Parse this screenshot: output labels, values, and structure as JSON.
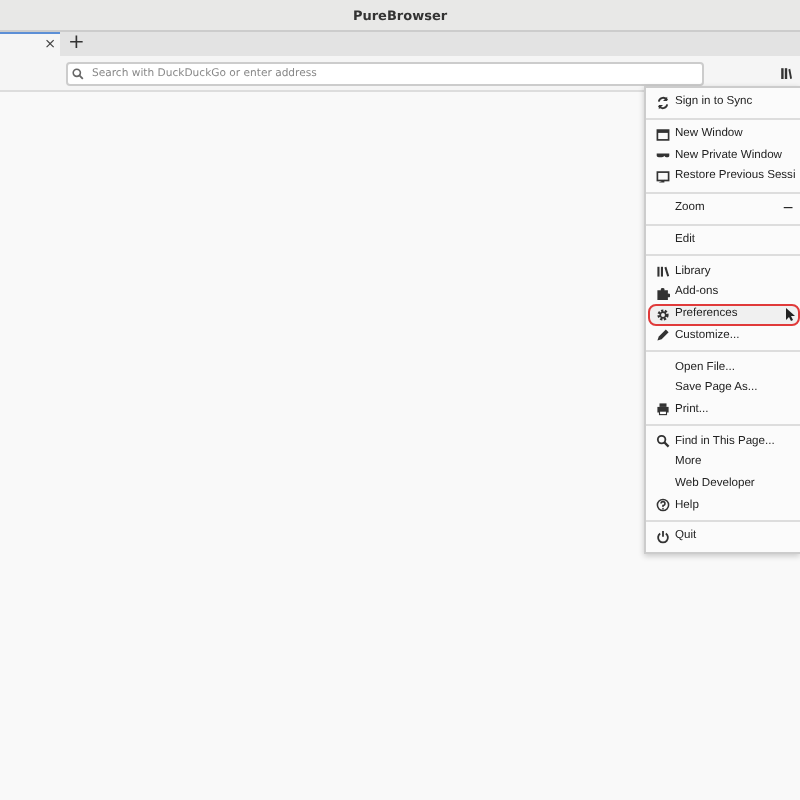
{
  "window": {
    "title": "PureBrowser"
  },
  "tabs": [
    {
      "close": "×",
      "selected": true
    }
  ],
  "new_tab": "+",
  "address_bar": {
    "placeholder": "Search with DuckDuckGo or enter address"
  },
  "menu": {
    "groups": [
      [
        {
          "kind": "item",
          "label": "Sign in to Sync",
          "highlighted": false
        }
      ],
      [
        {
          "kind": "item",
          "label": "New Window",
          "highlighted": false
        },
        {
          "kind": "item",
          "label": "New Private Window",
          "highlighted": false
        },
        {
          "kind": "item",
          "label": "Restore Previous Sessi",
          "highlighted": false
        }
      ],
      [
        {
          "kind": "zoom",
          "label": "Zoom",
          "control": "−",
          "highlighted": false
        }
      ],
      [
        {
          "kind": "item",
          "label": "Edit",
          "highlighted": false
        }
      ],
      [
        {
          "kind": "item",
          "label": "Library",
          "highlighted": false
        },
        {
          "kind": "item",
          "label": "Add-ons",
          "highlighted": false
        },
        {
          "kind": "item",
          "label": "Preferences",
          "highlighted": true
        },
        {
          "kind": "item",
          "label": "Customize...",
          "highlighted": false
        }
      ],
      [
        {
          "kind": "item",
          "label": "Open File...",
          "highlighted": false
        },
        {
          "kind": "item",
          "label": "Save Page As...",
          "highlighted": false
        },
        {
          "kind": "item",
          "label": "Print...",
          "highlighted": false
        }
      ],
      [
        {
          "kind": "item",
          "label": "Find in This Page...",
          "highlighted": false
        },
        {
          "kind": "item",
          "label": "More",
          "highlighted": false
        },
        {
          "kind": "item",
          "label": "Web Developer",
          "highlighted": false
        },
        {
          "kind": "item",
          "label": "Help",
          "highlighted": false
        }
      ],
      [
        {
          "kind": "item",
          "label": "Quit",
          "highlighted": false
        }
      ]
    ]
  }
}
